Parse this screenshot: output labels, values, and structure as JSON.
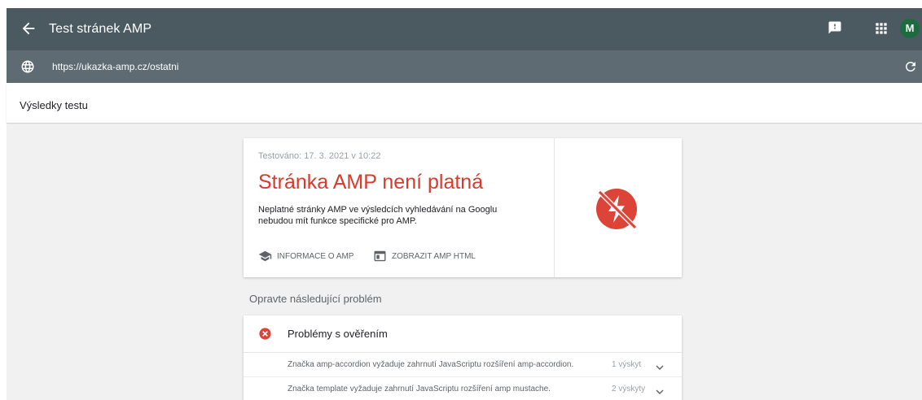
{
  "header": {
    "title": "Test stránek AMP",
    "avatar_letter": "M"
  },
  "urlbar": {
    "url": "https://ukazka-amp.cz/ostatni"
  },
  "results": {
    "label": "Výsledky testu"
  },
  "summary": {
    "tested": "Testováno: 17. 3. 2021 v 10:22",
    "headline": "Stránka AMP není platná",
    "description": "Neplatné stránky AMP ve výsledcích vyhledávání na Googlu nebudou mít funkce specifické pro AMP.",
    "link_info": "INFORMACE O AMP",
    "link_html": "ZOBRAZIT AMP HTML",
    "status_color": "#db4437"
  },
  "fix_label": "Opravte následující problém",
  "issues": {
    "title": "Problémy s ověřením",
    "rows": [
      {
        "text": "Značka amp-accordion vyžaduje zahrnutí JavaScriptu rozšíření amp-accordion.",
        "count": "1 výskyt"
      },
      {
        "text": "Značka template vyžaduje zahrnutí JavaScriptu rozšíření amp mustache.",
        "count": "2 výskyty"
      }
    ]
  },
  "icons": [
    "back-arrow-icon",
    "feedback-icon",
    "apps-icon",
    "globe-icon",
    "refresh-icon",
    "school-icon",
    "code-window-icon",
    "amp-invalid-icon",
    "error-icon",
    "chevron-down-icon"
  ]
}
